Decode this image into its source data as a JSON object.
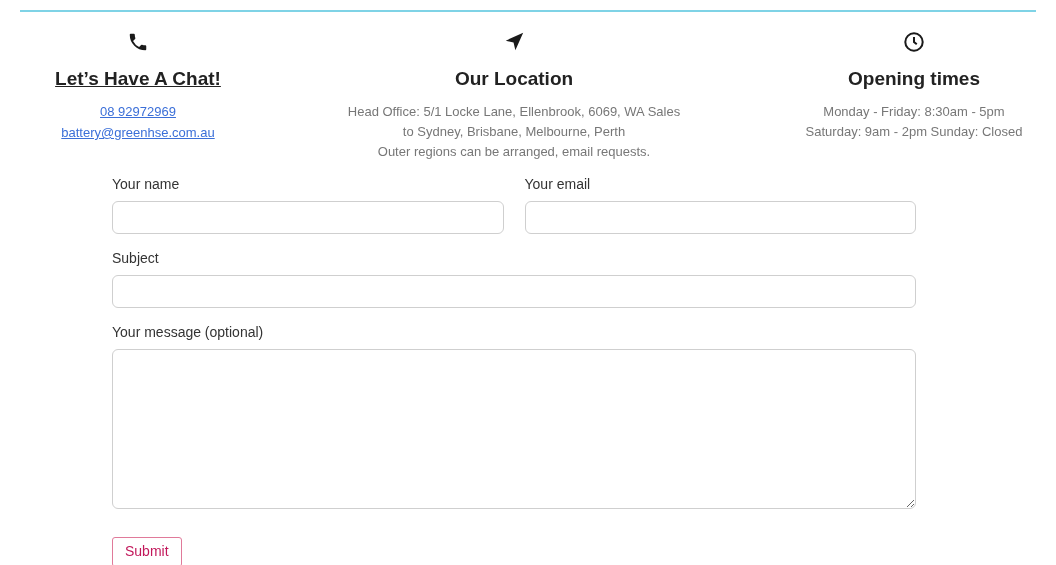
{
  "contact": {
    "heading": "Let’s Have A Chat!",
    "phone": "08 92972969",
    "email": "battery@greenhse.com.au"
  },
  "location": {
    "heading": "Our Location",
    "lines": [
      "Head Office: 5/1 Locke Lane, Ellenbrook, 6069, WA Sales",
      "to Sydney, Brisbane, Melbourne, Perth",
      "Outer regions can be arranged, email requests."
    ]
  },
  "hours": {
    "heading": "Opening times",
    "lines": [
      "Monday - Friday: 8:30am - 5pm",
      "Saturday: 9am - 2pm Sunday: Closed"
    ]
  },
  "form": {
    "name_label": "Your name",
    "email_label": "Your email",
    "subject_label": "Subject",
    "message_label": "Your message (optional)",
    "submit": "Submit"
  }
}
